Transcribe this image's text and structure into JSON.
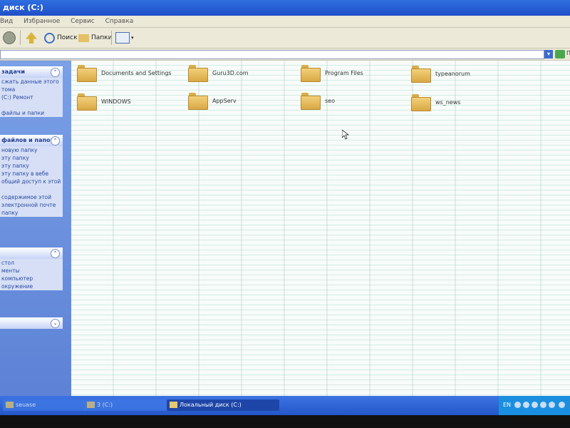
{
  "window": {
    "title": "диск (C:)"
  },
  "menu": [
    "Вид",
    "Избранное",
    "Сервис",
    "Справка"
  ],
  "toolbar": {
    "search_label": "Поиск",
    "folders_label": "Папки"
  },
  "address": {
    "go_label": "Пе"
  },
  "taskpane": {
    "boxes": [
      {
        "title": "задачи",
        "items": [
          "сжать данные этого",
          "тома",
          "(С:) Ремонт",
          "",
          "файлы и папки"
        ]
      },
      {
        "title": "файлов и папок",
        "items": [
          "новую папку",
          "эту папку",
          "эту папку",
          "эту папку в вебе",
          "общий доступ к этой",
          "",
          "содержимое этой",
          "электронной почте",
          "папку"
        ]
      },
      {
        "title": "",
        "items": [
          "стол",
          "менты",
          "компьютер",
          "окружение"
        ]
      },
      {
        "title": "",
        "items": []
      }
    ]
  },
  "folders": [
    {
      "name": "Documents and Settings"
    },
    {
      "name": "Guru3D.com"
    },
    {
      "name": "Program Files"
    },
    {
      "name": "typeanorum"
    },
    {
      "name": "WINDOWS"
    },
    {
      "name": "AppServ"
    },
    {
      "name": "seo"
    },
    {
      "name": "ws_news"
    }
  ],
  "taskbar": {
    "tasks": [
      {
        "label": "seuase"
      },
      {
        "label": "3 (C:)"
      },
      {
        "label": "Локальный диск (C:)"
      }
    ],
    "tray": {
      "lang": "EN"
    }
  },
  "colors": {
    "title_bar": "#2f6fe0",
    "task_pane": "#6a8fdc",
    "taskbar": "#2f63d4",
    "folder": "#e3b95a"
  }
}
